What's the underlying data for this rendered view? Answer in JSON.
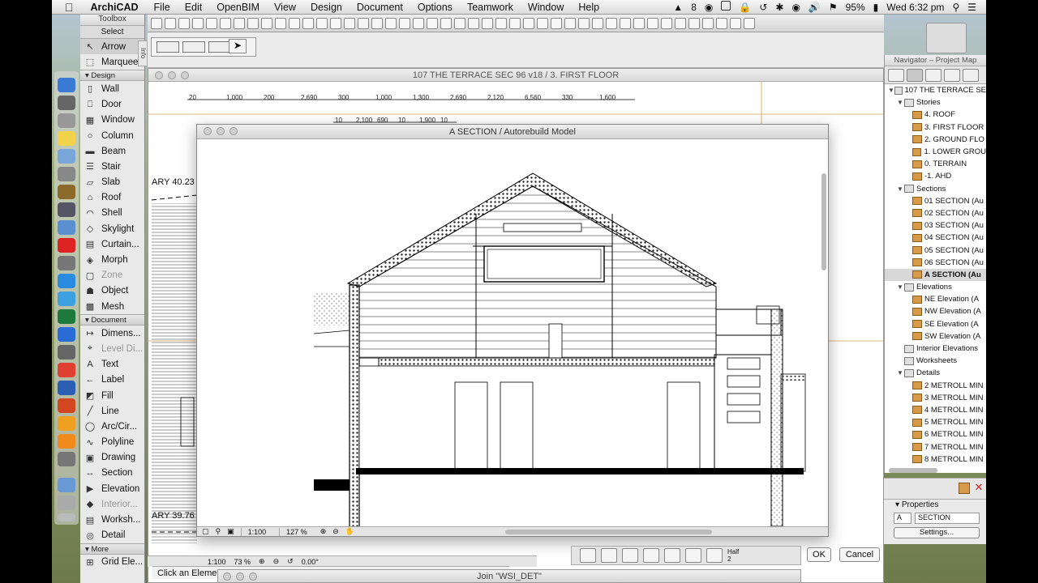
{
  "menubar": {
    "apple": "",
    "app": "ArchiCAD",
    "items": [
      "File",
      "Edit",
      "OpenBIM",
      "View",
      "Design",
      "Document",
      "Options",
      "Teamwork",
      "Window",
      "Help"
    ],
    "status_num": "8",
    "battery": "95%",
    "clock": "Wed 6:32 pm"
  },
  "toolbox": {
    "title": "Toolbox",
    "select_label": "Select",
    "select_items": [
      {
        "label": "Arrow",
        "icon": "arrow-icon"
      },
      {
        "label": "Marquee",
        "icon": "marquee-icon"
      }
    ],
    "design_label": "Design",
    "design_items": [
      {
        "label": "Wall",
        "icon": "wall-icon"
      },
      {
        "label": "Door",
        "icon": "door-icon"
      },
      {
        "label": "Window",
        "icon": "window-icon"
      },
      {
        "label": "Column",
        "icon": "column-icon"
      },
      {
        "label": "Beam",
        "icon": "beam-icon"
      },
      {
        "label": "Stair",
        "icon": "stair-icon"
      },
      {
        "label": "Slab",
        "icon": "slab-icon"
      },
      {
        "label": "Roof",
        "icon": "roof-icon"
      },
      {
        "label": "Shell",
        "icon": "shell-icon"
      },
      {
        "label": "Skylight",
        "icon": "skylight-icon"
      },
      {
        "label": "Curtain...",
        "icon": "curtain-wall-icon"
      },
      {
        "label": "Morph",
        "icon": "morph-icon"
      },
      {
        "label": "Zone",
        "icon": "zone-icon"
      },
      {
        "label": "Object",
        "icon": "object-icon"
      },
      {
        "label": "Mesh",
        "icon": "mesh-icon"
      }
    ],
    "document_label": "Document",
    "document_items": [
      {
        "label": "Dimens...",
        "icon": "dimension-icon"
      },
      {
        "label": "Level Di...",
        "icon": "level-dimension-icon"
      },
      {
        "label": "Text",
        "icon": "text-icon"
      },
      {
        "label": "Label",
        "icon": "label-icon"
      },
      {
        "label": "Fill",
        "icon": "fill-icon"
      },
      {
        "label": "Line",
        "icon": "line-icon"
      },
      {
        "label": "Arc/Cir...",
        "icon": "arc-icon"
      },
      {
        "label": "Polyline",
        "icon": "polyline-icon"
      },
      {
        "label": "Drawing",
        "icon": "drawing-icon"
      },
      {
        "label": "Section",
        "icon": "section-icon"
      },
      {
        "label": "Elevation",
        "icon": "elevation-icon"
      },
      {
        "label": "Interior...",
        "icon": "interior-elevation-icon"
      },
      {
        "label": "Worksh...",
        "icon": "worksheet-icon"
      },
      {
        "label": "Detail",
        "icon": "detail-icon"
      }
    ],
    "more_label": "More",
    "more_items": [
      {
        "label": "Grid Ele...",
        "icon": "grid-element-icon"
      }
    ]
  },
  "info_strip": "Info",
  "plan_window": {
    "title": "107 THE TERRACE SEC 96 v18 / 3. FIRST FLOOR",
    "dims_row1": [
      "20",
      "1,000",
      "200",
      "2,690",
      "300",
      "1,000",
      "1,300",
      "2,690",
      "2,120",
      "6,560",
      "330",
      "1,600"
    ],
    "dims_row2": [
      "10",
      "2,100",
      "690",
      "10",
      "1,900",
      "10"
    ],
    "left_label_1": "ARY  40.23",
    "left_label_2": "ARY  39.76",
    "status_scale": "1:100",
    "status_zoom": "73 %",
    "status_angle": "0.00°"
  },
  "section_window": {
    "title": "A SECTION / Autorebuild Model",
    "status_scale": "1:100",
    "status_zoom": "127 %"
  },
  "message_bar": "Click an Eleme",
  "join_window_title": "Join \"WSI_DET\"",
  "bottom_tools": {
    "half_label": "Half",
    "half_value": "2"
  },
  "dialog_buttons": {
    "ok": "OK",
    "cancel": "Cancel"
  },
  "navigator": {
    "title": "Navigator – Project Map",
    "rows": [
      {
        "label": "107 THE TERRACE SE",
        "indent": 0,
        "type": "project",
        "tri": "▼"
      },
      {
        "label": "Stories",
        "indent": 1,
        "type": "group",
        "tri": "▼"
      },
      {
        "label": "4. ROOF",
        "indent": 2,
        "type": "item",
        "tri": ""
      },
      {
        "label": "3. FIRST FLOOR",
        "indent": 2,
        "type": "item",
        "tri": ""
      },
      {
        "label": "2. GROUND FLO",
        "indent": 2,
        "type": "item",
        "tri": ""
      },
      {
        "label": "1. LOWER GROU",
        "indent": 2,
        "type": "item",
        "tri": ""
      },
      {
        "label": "0. TERRAIN",
        "indent": 2,
        "type": "item",
        "tri": ""
      },
      {
        "label": "-1. AHD",
        "indent": 2,
        "type": "item",
        "tri": ""
      },
      {
        "label": "Sections",
        "indent": 1,
        "type": "group",
        "tri": "▼"
      },
      {
        "label": "01 SECTION (Au",
        "indent": 2,
        "type": "item",
        "tri": ""
      },
      {
        "label": "02 SECTION (Au",
        "indent": 2,
        "type": "item",
        "tri": ""
      },
      {
        "label": "03 SECTION (Au",
        "indent": 2,
        "type": "item",
        "tri": ""
      },
      {
        "label": "04 SECTION (Au",
        "indent": 2,
        "type": "item",
        "tri": ""
      },
      {
        "label": "05 SECTION (Au",
        "indent": 2,
        "type": "item",
        "tri": ""
      },
      {
        "label": "06 SECTION (Au",
        "indent": 2,
        "type": "item",
        "tri": ""
      },
      {
        "label": "A SECTION (Au",
        "indent": 2,
        "type": "item",
        "tri": "",
        "selected": true
      },
      {
        "label": "Elevations",
        "indent": 1,
        "type": "group",
        "tri": "▼"
      },
      {
        "label": "NE Elevation (A",
        "indent": 2,
        "type": "item",
        "tri": ""
      },
      {
        "label": "NW Elevation (A",
        "indent": 2,
        "type": "item",
        "tri": ""
      },
      {
        "label": "SE Elevation (A",
        "indent": 2,
        "type": "item",
        "tri": ""
      },
      {
        "label": "SW Elevation (A",
        "indent": 2,
        "type": "item",
        "tri": ""
      },
      {
        "label": "Interior Elevations",
        "indent": 1,
        "type": "group",
        "tri": ""
      },
      {
        "label": "Worksheets",
        "indent": 1,
        "type": "group",
        "tri": ""
      },
      {
        "label": "Details",
        "indent": 1,
        "type": "group",
        "tri": "▼"
      },
      {
        "label": "2 METROLL MIN",
        "indent": 2,
        "type": "item",
        "tri": ""
      },
      {
        "label": "3 METROLL MIN",
        "indent": 2,
        "type": "item",
        "tri": ""
      },
      {
        "label": "4 METROLL MIN",
        "indent": 2,
        "type": "item",
        "tri": ""
      },
      {
        "label": "5 METROLL MIN",
        "indent": 2,
        "type": "item",
        "tri": ""
      },
      {
        "label": "6 METROLL MIN",
        "indent": 2,
        "type": "item",
        "tri": ""
      },
      {
        "label": "7 METROLL MIN",
        "indent": 2,
        "type": "item",
        "tri": ""
      },
      {
        "label": "8 METROLL MIN",
        "indent": 2,
        "type": "item",
        "tri": ""
      }
    ]
  },
  "properties": {
    "title": "Properties",
    "id_value": "A",
    "name_value": "SECTION",
    "settings_label": "Settings..."
  }
}
